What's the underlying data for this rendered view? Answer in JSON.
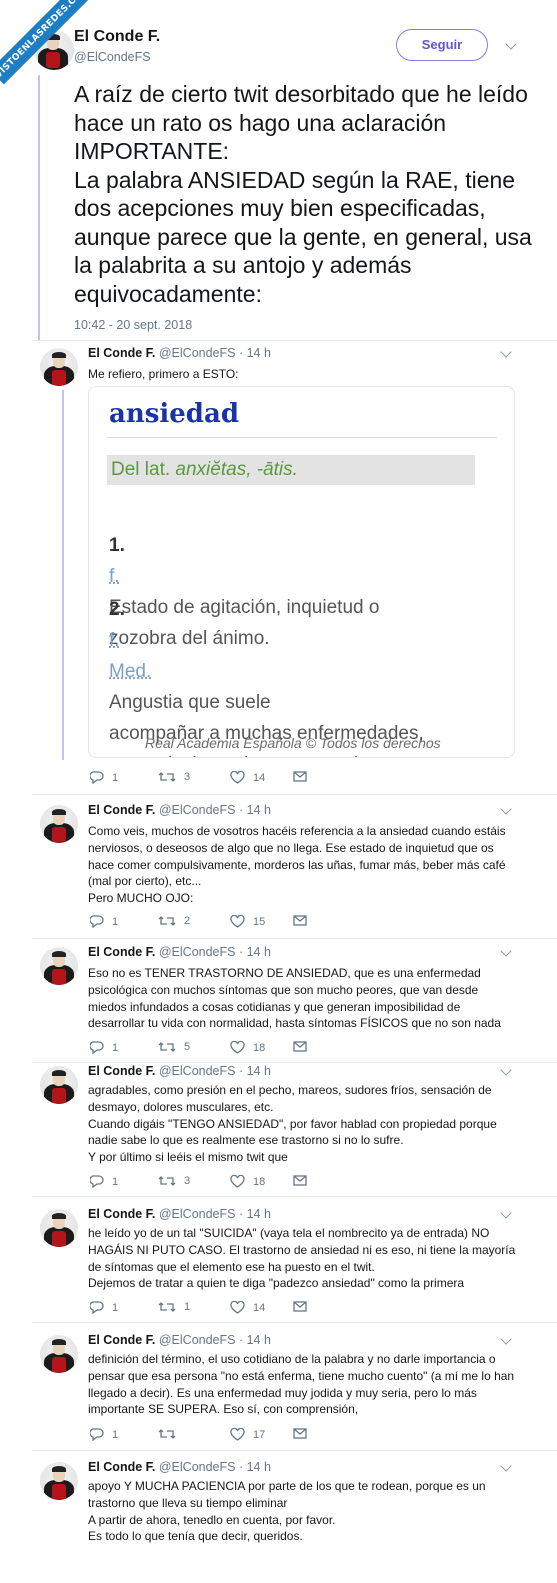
{
  "watermark": "VISTOENLASREDES.COM",
  "tweet": {
    "author_name": "El Conde F.",
    "author_handle": "@ElCondeFS",
    "follow_label": "Seguir",
    "text": "A raíz de cierto twit desorbitado que he leído hace un rato os hago una aclaración IMPORTANTE:\nLa palabra ANSIEDAD según la RAE, tiene dos acepciones muy bien especificadas, aunque parece que la gente, en general, usa la palabrita a su antojo y además equivocadamente:",
    "timestamp": "10:42 - 20 sept. 2018"
  },
  "dictionary": {
    "word": "ansiedad",
    "etym_prefix": "Del lat.",
    "etym_word": "anxiĕtas, -ātis.",
    "def1_num": "1.",
    "def1_abbr": "f.",
    "def1_text": "Estado de agitación, inquietud o\nzozobra del ánimo.",
    "def2_num": "2.",
    "def2_abbr1": "f.",
    "def2_abbr2": "Med.",
    "def2_text_first": "Angustia que suele",
    "def2_text_rest": "acompañar a muchas enfermedades,\nen particular a ciertas neurosis, y\nque no permite sosiego a los\nenfermos.",
    "footer": "Real Academia Española © Todos los derechos"
  },
  "replies": [
    {
      "name": "El Conde F.",
      "handle": "@ElCondeFS",
      "time": "· 14 h",
      "text": "Me refiero, primero a ESTO:",
      "replies": "1",
      "retweets": "3",
      "likes": "14"
    },
    {
      "name": "El Conde F.",
      "handle": "@ElCondeFS",
      "time": "· 14 h",
      "text": "Como veis, muchos de vosotros hacéis referencia a la ansiedad cuando estáis\nnerviosos, o deseosos de algo que no llega. Ese estado de inquietud que os\nhace comer compulsivamente, morderos las uñas, fumar más, beber más café\n(mal por cierto), etc...\nPero MUCHO OJO:",
      "replies": "1",
      "retweets": "2",
      "likes": "15"
    },
    {
      "name": "El Conde F.",
      "handle": "@ElCondeFS",
      "time": "· 14 h",
      "text": "Eso no es TENER TRASTORNO DE ANSIEDAD, que es una enfermedad\npsicológica con muchos síntomas que son mucho peores, que van desde\nmiedos infundados a cosas cotidianas y que generan imposibilidad de\ndesarrollar tu vida con normalidad, hasta síntomas FÍSICOS que no son nada",
      "replies": "1",
      "retweets": "5",
      "likes": "18"
    },
    {
      "name": "El Conde F.",
      "handle": "@ElCondeFS",
      "time": "· 14 h",
      "text": "agradables, como presión en el pecho, mareos, sudores fríos, sensación de\ndesmayo, dolores musculares, etc.\nCuando digáis \"TENGO ANSIEDAD\", por favor hablad con propiedad porque\nnadie sabe lo que es realmente ese trastorno si no lo sufre.\nY por último si leéis el mismo twit que",
      "replies": "1",
      "retweets": "3",
      "likes": "18"
    },
    {
      "name": "El Conde F.",
      "handle": "@ElCondeFS",
      "time": "· 14 h",
      "text": "he leído yo de un tal \"SUICIDA\" (vaya tela el nombrecito ya de entrada) NO\nHAGÁIS NI PUTO CASO. El trastorno de ansiedad ni es eso, ni tiene la mayoría\nde síntomas que el elemento ese ha puesto en el twit.\nDejemos de tratar a quien te diga \"padezco ansiedad\" como la primera",
      "replies": "1",
      "retweets": "1",
      "likes": "14"
    },
    {
      "name": "El Conde F.",
      "handle": "@ElCondeFS",
      "time": "· 14 h",
      "text": "definición del término, el uso cotidiano de la palabra y no darle importancia o\npensar que esa persona \"no está enferma, tiene mucho cuento\" (a mí me lo han\nllegado a decir). Es una enfermedad muy jodida y muy seria, pero lo más\nimportante SE SUPERA. Eso sí, con comprensión,",
      "replies": "1",
      "retweets": "",
      "likes": "17"
    },
    {
      "name": "El Conde F.",
      "handle": "@ElCondeFS",
      "time": "· 14 h",
      "text": "apoyo Y MUCHA PACIENCIA por parte de los que te rodean, porque es un\ntrastorno que lleva su tiempo eliminar\nA partir de ahora, tenedlo en cuenta, por favor.\nEs todo lo que tenía que decir, queridos."
    }
  ],
  "colors": {
    "link": "#1a33a6",
    "accent": "#6c55c9",
    "muted": "#657786",
    "etym": "#5a9a3c"
  },
  "icons": [
    "reply-icon",
    "retweet-icon",
    "like-icon",
    "dm-icon",
    "chevron-down-icon"
  ]
}
